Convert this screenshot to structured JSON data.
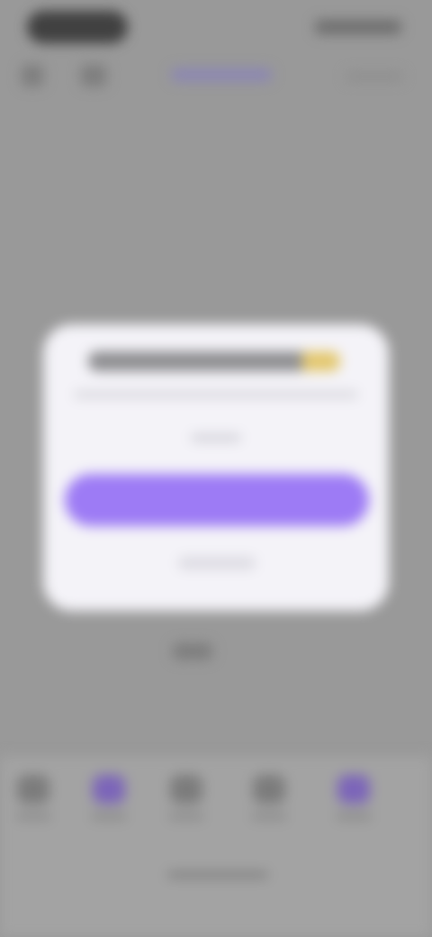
{
  "status_bar": {
    "time": "",
    "indicators": ""
  },
  "header": {
    "title": "",
    "right_action": ""
  },
  "dialog": {
    "title": "",
    "message": "",
    "secondary_text": "",
    "primary_button": "",
    "dismiss_button": ""
  },
  "tabbar": {
    "items": [
      {
        "label": "",
        "icon": "tab-icon"
      },
      {
        "label": "",
        "icon": "tab-icon"
      },
      {
        "label": "",
        "icon": "tab-icon"
      },
      {
        "label": "",
        "icon": "tab-icon"
      },
      {
        "label": "",
        "icon": "tab-icon"
      }
    ]
  },
  "colors": {
    "accent": "#9d7bf5",
    "dialog_bg": "#f4f3f8",
    "overlay": "#999999"
  }
}
